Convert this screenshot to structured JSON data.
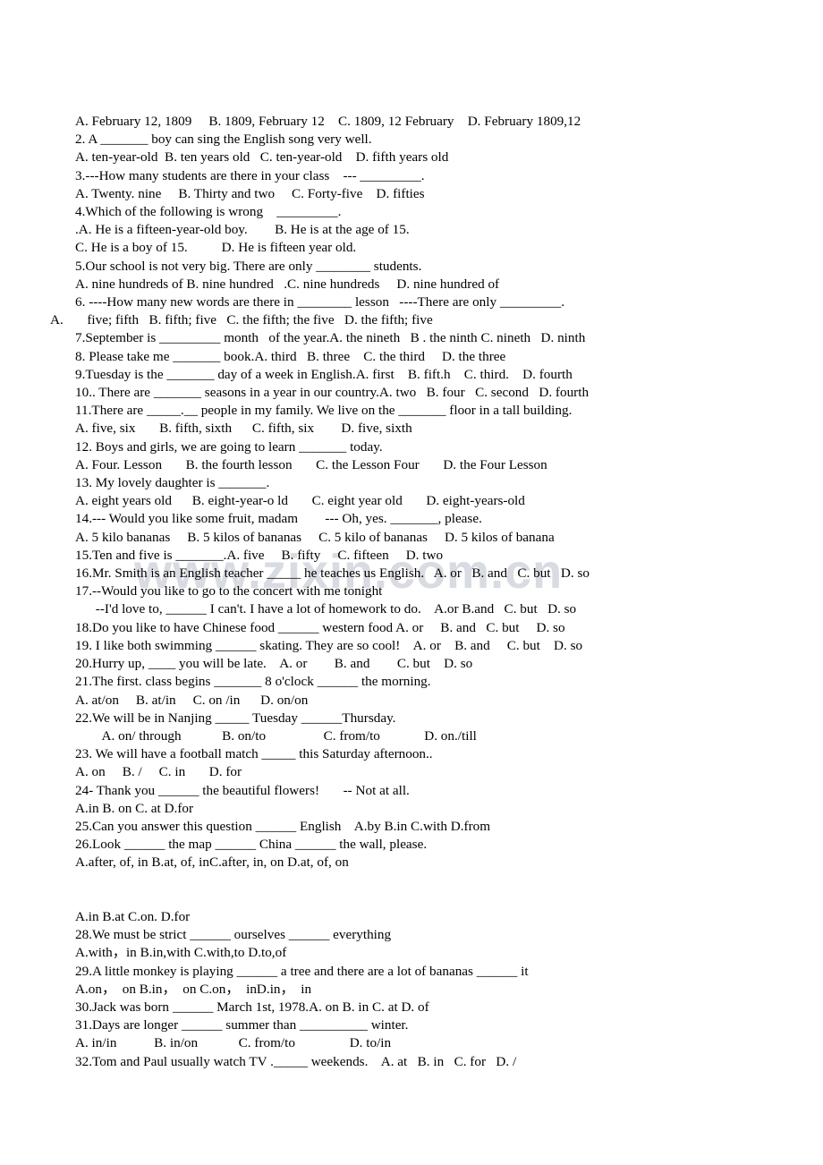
{
  "document": {
    "watermark": "www.zixin.com.cn",
    "lines": [
      {
        "text": "A. February 12, 1809     B. 1809, February 12    C. 1809, 12 February    D. February 1809,12",
        "style": "normal"
      },
      {
        "text": "2. A _______ boy can sing the English song very well.",
        "style": "normal"
      },
      {
        "text": "A. ten-year-old  B. ten years old   C. ten-year-old    D. fifth years old",
        "style": "normal"
      },
      {
        "text": "3.---How many students are there in your class    --- _________.",
        "style": "normal"
      },
      {
        "text": "A. Twenty. nine     B. Thirty and two     C. Forty-five    D. fifties",
        "style": "normal"
      },
      {
        "text": "4.Which of the following is wrong    _________.",
        "style": "normal"
      },
      {
        "text": ".A. He is a fifteen-year-old boy.        B. He is at the age of 15.",
        "style": "normal"
      },
      {
        "text": "C. He is a boy of 15.          D. He is fifteen year old.",
        "style": "normal"
      },
      {
        "text": "5.Our school is not very big. There are only ________ students.",
        "style": "normal"
      },
      {
        "text": "A. nine hundreds of B. nine hundred   .C. nine hundreds     D. nine hundred of",
        "style": "normal"
      },
      {
        "text": "6. ----How many new words are there in ________ lesson   ----There are only _________.",
        "style": "normal"
      },
      {
        "text": "A.       five; fifth   B. fifth; five   C. the fifth; the five   D. the fifth; five",
        "style": "hang"
      },
      {
        "text": "7.September is _________ month   of the year.A. the nineth   B . the ninth C. nineth   D. ninth",
        "style": "normal"
      },
      {
        "text": "8. Please take me _______ book.A. third   B. three    C. the third     D. the three",
        "style": "normal"
      },
      {
        "text": "9.Tuesday is the _______ day of a week in English.A. first    B. fift.h    C. third.    D. fourth",
        "style": "normal"
      },
      {
        "text": "10.. There are _______ seasons in a year in our country.A. two   B. four   C. second   D. fourth",
        "style": "normal"
      },
      {
        "text": "11.There are _____.__ people in my family. We live on the _______ floor in a tall building.",
        "style": "normal"
      },
      {
        "text": "A. five, six       B. fifth, sixth      C. fifth, six        D. five, sixth",
        "style": "normal"
      },
      {
        "text": "12. Boys and girls, we are going to learn _______ today.",
        "style": "normal"
      },
      {
        "text": "A. Four. Lesson       B. the fourth lesson       C. the Lesson Four       D. the Four Lesson",
        "style": "normal"
      },
      {
        "text": "13. My lovely daughter is _______.",
        "style": "normal"
      },
      {
        "text": "A. eight years old      B. eight-year-o ld       C. eight year old       D. eight-years-old",
        "style": "normal"
      },
      {
        "text": "14.--- Would you like some fruit, madam        --- Oh, yes. _______, please.",
        "style": "normal"
      },
      {
        "text": "A. 5 kilo bananas     B. 5 kilos of bananas     C. 5 kilo of bananas     D. 5 kilos of banana",
        "style": "normal"
      },
      {
        "text": "15.Ten and five is _______.A. five     B. fifty     C. fifteen     D. two",
        "style": "normal"
      },
      {
        "text": "16.Mr. Smith is an English teacher _____ he teaches us English.   A. or   B. and   C. but   D. so",
        "style": "normal"
      },
      {
        "text": "17.--Would you like to go to the concert with me tonight",
        "style": "normal"
      },
      {
        "text": "      --I'd love to, ______ I can't. I have a lot of homework to do.    A.or B.and   C. but   D. so",
        "style": "normal"
      },
      {
        "text": "18.Do you like to have Chinese food ______ western food A. or     B. and   C. but     D. so",
        "style": "normal"
      },
      {
        "text": "19. I like both swimming ______ skating. They are so cool!    A. or    B. and     C. but    D. so",
        "style": "normal"
      },
      {
        "text": "20.Hurry up, ____ you will be late.    A. or        B. and        C. but    D. so",
        "style": "normal"
      },
      {
        "text": "21.The first. class begins _______ 8 o'clock ______ the morning.",
        "style": "normal"
      },
      {
        "text": "A. at/on     B. at/in     C. on /in      D. on/on",
        "style": "normal"
      },
      {
        "text": "22.We will be in Nanjing _____ Tuesday ______Thursday.",
        "style": "normal"
      },
      {
        "text": "        A. on/ through            B. on/to                 C. from/to             D. on./till",
        "style": "normal"
      },
      {
        "text": "23. We will have a football match _____ this Saturday afternoon..",
        "style": "normal"
      },
      {
        "text": "A. on     B. /     C. in       D. for",
        "style": "normal"
      },
      {
        "text": "24- Thank you ______ the beautiful flowers!       -- Not at all.",
        "style": "normal"
      },
      {
        "text": "A.in B. on C. at D.for",
        "style": "normal"
      },
      {
        "text": "25.Can you answer this question ______ English    A.by B.in C.with D.from",
        "style": "normal"
      },
      {
        "text": "26.Look ______ the map ______ China ______ the wall, please.",
        "style": "normal"
      },
      {
        "text": "A.after, of, in B.at, of, inC.after, in, on D.at, of, on",
        "style": "normal"
      },
      {
        "text": "",
        "style": "blank"
      },
      {
        "text": "",
        "style": "blank"
      },
      {
        "text": "A.in B.at C.on. D.for",
        "style": "normal"
      },
      {
        "text": "28.We must be strict ______ ourselves ______ everything",
        "style": "normal"
      },
      {
        "text": "A.with，in B.in,with C.with,to D.to,of",
        "style": "normal"
      },
      {
        "text": "29.A little monkey is playing ______ a tree and there are a lot of bananas ______ it",
        "style": "normal"
      },
      {
        "text": "A.on，  on B.in，  on C.on，  inD.in，  in",
        "style": "normal"
      },
      {
        "text": "30.Jack was born ______ March 1st, 1978.A. on B. in C. at D. of",
        "style": "normal"
      },
      {
        "text": "31.Days are longer ______ summer than __________ winter.",
        "style": "normal"
      },
      {
        "text": "A. in/in           B. in/on            C. from/to                D. to/in",
        "style": "normal"
      },
      {
        "text": "32.Tom and Paul usually watch TV ._____ weekends.    A. at   B. in   C. for   D. /",
        "style": "normal"
      }
    ]
  }
}
